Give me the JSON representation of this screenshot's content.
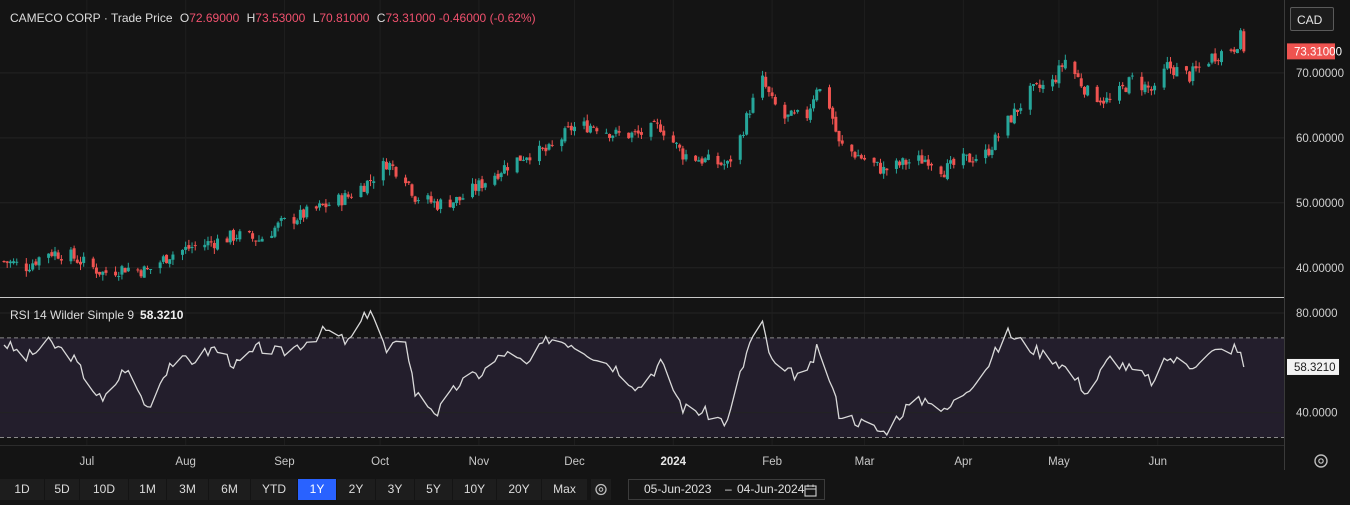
{
  "header": {
    "symbol": "CAMECO CORP",
    "price_type": "Trade Price",
    "open_key": "O",
    "open": "72.69000",
    "high_key": "H",
    "high": "73.53000",
    "low_key": "L",
    "low": "70.81000",
    "close_key": "C",
    "close": "73.31000",
    "change": "-0.46000",
    "change_pct": "(-0.62%)",
    "currency": "CAD",
    "last_price_label": "73.31000"
  },
  "rsi": {
    "legend": "RSI 14 Wilder Simple 9",
    "value": "58.3210",
    "upper_band": 70,
    "lower_band": 30,
    "tick_labels": [
      "80.0000",
      "40.0000"
    ]
  },
  "colors": {
    "up": "#26a69a",
    "down": "#ef5350",
    "accent": "#2962ff",
    "rsi_line": "#d9d9d9",
    "band_fill": "#231e2c"
  },
  "toolbar": {
    "ranges": [
      "1D",
      "5D",
      "10D",
      "1M",
      "3M",
      "6M",
      "YTD",
      "1Y",
      "2Y",
      "3Y",
      "5Y",
      "10Y",
      "20Y",
      "Max"
    ],
    "active_range": "1Y",
    "date_from": "05-Jun-2023",
    "date_sep": "–",
    "date_to": "04-Jun-2024",
    "calendar_icon": "calendar-icon",
    "settings_icon": "gear-icon"
  },
  "chart_data": [
    {
      "type": "candlestick",
      "title": "CAMECO CORP · Trade Price",
      "y_tick_labels": [
        "70.00000",
        "60.00000",
        "50.00000",
        "40.00000"
      ],
      "ylim": [
        35.5,
        76.6
      ],
      "x_months": [
        "Jul",
        "Aug",
        "Sep",
        "Oct",
        "Nov",
        "Dec",
        "2024",
        "Feb",
        "Mar",
        "Apr",
        "May",
        "Jun"
      ],
      "x_month_dates": [
        "2023-07-01",
        "2023-08-01",
        "2023-09-01",
        "2023-10-01",
        "2023-11-01",
        "2023-12-01",
        "2024-01-01",
        "2024-02-01",
        "2024-03-01",
        "2024-04-01",
        "2024-05-01",
        "2024-06-01"
      ],
      "x_range": [
        "2023-06-05",
        "2024-06-04"
      ],
      "anchors_close": [
        [
          "2023-06-05",
          41.0
        ],
        [
          "2023-06-12",
          40.2
        ],
        [
          "2023-06-19",
          42.5
        ],
        [
          "2023-06-26",
          41.8
        ],
        [
          "2023-07-06",
          39.2
        ],
        [
          "2023-07-13",
          40.0
        ],
        [
          "2023-07-20",
          39.5
        ],
        [
          "2023-07-27",
          42.0
        ],
        [
          "2023-08-03",
          43.2
        ],
        [
          "2023-08-10",
          44.0
        ],
        [
          "2023-08-17",
          45.0
        ],
        [
          "2023-08-24",
          44.3
        ],
        [
          "2023-08-31",
          46.8
        ],
        [
          "2023-09-07",
          48.2
        ],
        [
          "2023-09-14",
          49.6
        ],
        [
          "2023-09-21",
          51.0
        ],
        [
          "2023-09-28",
          53.5
        ],
        [
          "2023-10-03",
          56.2
        ],
        [
          "2023-10-09",
          54.0
        ],
        [
          "2023-10-12",
          51.0
        ],
        [
          "2023-10-19",
          49.8
        ],
        [
          "2023-10-26",
          50.5
        ],
        [
          "2023-11-02",
          53.0
        ],
        [
          "2023-11-09",
          55.5
        ],
        [
          "2023-11-16",
          57.5
        ],
        [
          "2023-11-23",
          58.0
        ],
        [
          "2023-11-30",
          61.5
        ],
        [
          "2023-12-07",
          62.0
        ],
        [
          "2023-12-14",
          60.5
        ],
        [
          "2023-12-21",
          60.5
        ],
        [
          "2023-12-28",
          61.8
        ],
        [
          "2024-01-04",
          57.5
        ],
        [
          "2024-01-11",
          56.5
        ],
        [
          "2024-01-18",
          55.8
        ],
        [
          "2024-01-22",
          60.0
        ],
        [
          "2024-01-25",
          64.5
        ],
        [
          "2024-01-29",
          68.8
        ],
        [
          "2024-02-01",
          65.5
        ],
        [
          "2024-02-05",
          63.0
        ],
        [
          "2024-02-12",
          63.5
        ],
        [
          "2024-02-15",
          68.0
        ],
        [
          "2024-02-19",
          65.0
        ],
        [
          "2024-02-22",
          59.0
        ],
        [
          "2024-02-29",
          57.0
        ],
        [
          "2024-03-07",
          55.0
        ],
        [
          "2024-03-14",
          56.2
        ],
        [
          "2024-03-21",
          56.8
        ],
        [
          "2024-03-26",
          55.0
        ],
        [
          "2024-04-01",
          56.5
        ],
        [
          "2024-04-08",
          57.5
        ],
        [
          "2024-04-15",
          62.5
        ],
        [
          "2024-04-22",
          67.0
        ],
        [
          "2024-04-29",
          68.5
        ],
        [
          "2024-05-03",
          72.0
        ],
        [
          "2024-05-10",
          67.0
        ],
        [
          "2024-05-17",
          65.5
        ],
        [
          "2024-05-24",
          69.0
        ],
        [
          "2024-05-31",
          67.0
        ],
        [
          "2024-06-04",
          71.0
        ],
        [
          "2024-06-11",
          69.5
        ],
        [
          "2024-06-18",
          72.5
        ],
        [
          "2024-06-25",
          74.0
        ],
        [
          "2024-06-27",
          75.5
        ],
        [
          "2024-06-29",
          73.31
        ]
      ],
      "last_close": 73.31
    },
    {
      "type": "line",
      "title": "RSI 14 Wilder Simple 9",
      "ylim": [
        27,
        86
      ],
      "y_tick_labels": [
        "80.0000",
        "40.0000"
      ],
      "bands": [
        70,
        30
      ],
      "anchors": [
        [
          "2023-06-05",
          68
        ],
        [
          "2023-06-12",
          62
        ],
        [
          "2023-06-19",
          68
        ],
        [
          "2023-06-26",
          63
        ],
        [
          "2023-07-06",
          44
        ],
        [
          "2023-07-13",
          58
        ],
        [
          "2023-07-20",
          42
        ],
        [
          "2023-07-27",
          60
        ],
        [
          "2023-08-03",
          61
        ],
        [
          "2023-08-10",
          66
        ],
        [
          "2023-08-17",
          59
        ],
        [
          "2023-08-24",
          66
        ],
        [
          "2023-08-31",
          64
        ],
        [
          "2023-09-07",
          68
        ],
        [
          "2023-09-14",
          73
        ],
        [
          "2023-09-21",
          68
        ],
        [
          "2023-09-28",
          82
        ],
        [
          "2023-10-03",
          64
        ],
        [
          "2023-10-09",
          70
        ],
        [
          "2023-10-12",
          48
        ],
        [
          "2023-10-19",
          40
        ],
        [
          "2023-10-26",
          52
        ],
        [
          "2023-11-02",
          56
        ],
        [
          "2023-11-09",
          64
        ],
        [
          "2023-11-16",
          59
        ],
        [
          "2023-11-23",
          70
        ],
        [
          "2023-11-30",
          68
        ],
        [
          "2023-12-07",
          63
        ],
        [
          "2023-12-14",
          58
        ],
        [
          "2023-12-21",
          50
        ],
        [
          "2023-12-28",
          60
        ],
        [
          "2024-01-04",
          42
        ],
        [
          "2024-01-11",
          40
        ],
        [
          "2024-01-18",
          36
        ],
        [
          "2024-01-22",
          55
        ],
        [
          "2024-01-25",
          68
        ],
        [
          "2024-01-29",
          75
        ],
        [
          "2024-02-01",
          60
        ],
        [
          "2024-02-05",
          56
        ],
        [
          "2024-02-12",
          55
        ],
        [
          "2024-02-15",
          65
        ],
        [
          "2024-02-19",
          54
        ],
        [
          "2024-02-22",
          40
        ],
        [
          "2024-02-29",
          36
        ],
        [
          "2024-03-07",
          32
        ],
        [
          "2024-03-14",
          42
        ],
        [
          "2024-03-21",
          46
        ],
        [
          "2024-03-26",
          40
        ],
        [
          "2024-04-01",
          48
        ],
        [
          "2024-04-08",
          58
        ],
        [
          "2024-04-15",
          72
        ],
        [
          "2024-04-22",
          66
        ],
        [
          "2024-04-29",
          62
        ],
        [
          "2024-05-03",
          58
        ],
        [
          "2024-05-10",
          48
        ],
        [
          "2024-05-17",
          62
        ],
        [
          "2024-05-24",
          57
        ],
        [
          "2024-05-31",
          52
        ],
        [
          "2024-06-04",
          62
        ],
        [
          "2024-06-11",
          59
        ],
        [
          "2024-06-18",
          64
        ],
        [
          "2024-06-25",
          66
        ],
        [
          "2024-06-27",
          63
        ],
        [
          "2024-06-29",
          58.3
        ]
      ],
      "last_value": 58.321
    }
  ]
}
